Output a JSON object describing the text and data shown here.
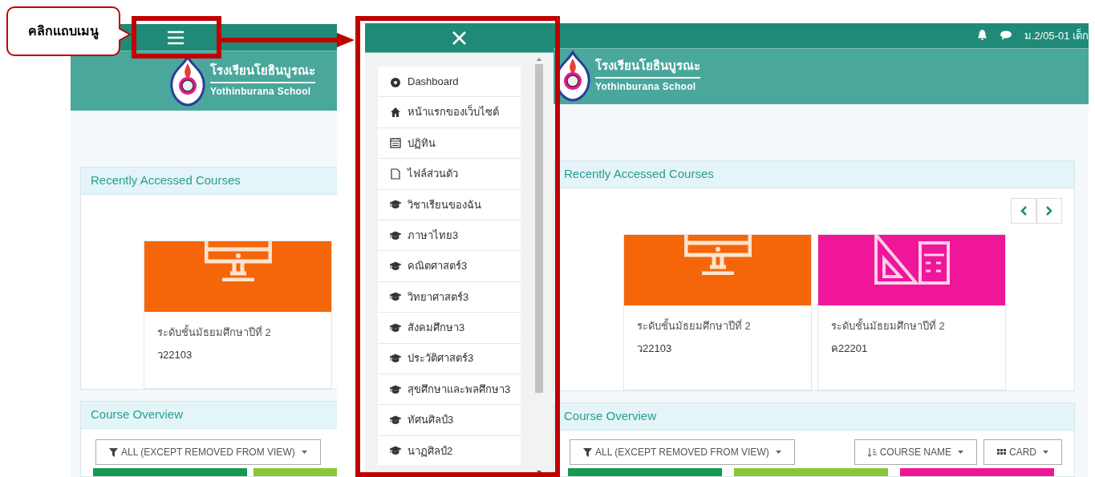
{
  "annotations": {
    "callout": "คลิกแถบเมนู"
  },
  "left_page": {
    "school_th": "โรงเรียนโยธินบูรณะ",
    "school_en": "Yothinburana School",
    "recent_title": "Recently Accessed Courses",
    "courses": [
      {
        "category": "ระดับชั้นมัธยมศึกษาปีที่ 2",
        "code": "ว22103",
        "color": "#f5660a",
        "kind": "monitor"
      }
    ],
    "overview_title": "Course Overview",
    "filter_label": "ALL (EXCEPT REMOVED FROM VIEW)"
  },
  "right_page": {
    "user": "ม.2/05-01 เด็ก",
    "drawer": {
      "items": [
        {
          "kind": "dashboard",
          "label": "Dashboard"
        },
        {
          "kind": "home",
          "label": "หน้าแรกของเว็บไซต์"
        },
        {
          "kind": "calendar",
          "label": "ปฏิทิน"
        },
        {
          "kind": "file",
          "label": "ไฟล์ส่วนตัว"
        },
        {
          "kind": "course",
          "label": "วิชาเรียนของฉัน"
        },
        {
          "kind": "course",
          "label": "ภาษาไทย3"
        },
        {
          "kind": "course",
          "label": "คณิตศาสตร์3"
        },
        {
          "kind": "course",
          "label": "วิทยาศาสตร์3"
        },
        {
          "kind": "course",
          "label": "สังคมศึกษา3"
        },
        {
          "kind": "course",
          "label": "ประวัติศาสตร์3"
        },
        {
          "kind": "course",
          "label": "สุขศึกษาและพลศึกษา3"
        },
        {
          "kind": "course",
          "label": "ทัศนศิลป์3"
        },
        {
          "kind": "course",
          "label": "นาฏศิลป์2"
        }
      ]
    },
    "school_th": "โรงเรียนโยธินบูรณะ",
    "school_en": "Yothinburana School",
    "recent_title": "Recently Accessed Courses",
    "courses": [
      {
        "category": "ระดับชั้นมัธยมศึกษาปีที่ 2",
        "code": "ว22103",
        "color": "#f5660a",
        "kind": "monitor"
      },
      {
        "category": "ระดับชั้นมัธยมศึกษาปีที่ 2",
        "code": "ค22201",
        "color": "#f0169a",
        "kind": "math"
      }
    ],
    "overview_title": "Course Overview",
    "filter_label": "ALL (EXCEPT REMOVED FROM VIEW)",
    "sort_label": "COURSE NAME",
    "view_label": "CARD"
  }
}
